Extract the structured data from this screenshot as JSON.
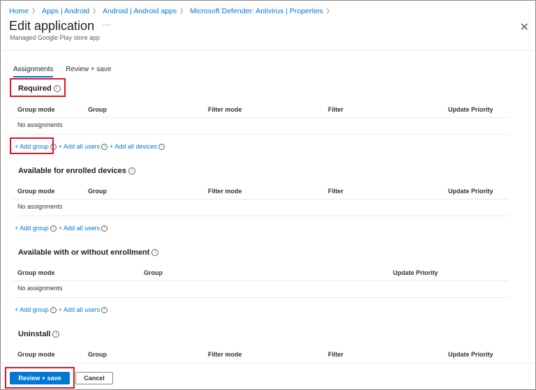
{
  "breadcrumb": [
    "Home",
    "Apps | Android",
    "Android | Android apps",
    "Microsoft Defender: Antivirus | Properties"
  ],
  "header": {
    "title": "Edit application",
    "more": "···",
    "subtitle": "Managed Google Play store app",
    "close": "✕"
  },
  "tabs": [
    "Assignments",
    "Review + save"
  ],
  "sections": {
    "required": {
      "title": "Required",
      "columns": [
        "Group mode",
        "Group",
        "Filter mode",
        "Filter",
        "Update Priority"
      ],
      "empty": "No assignments",
      "links": [
        "+ Add group",
        "+ Add all users",
        "+ Add all devices"
      ]
    },
    "enrolled": {
      "title": "Available for enrolled devices",
      "columns": [
        "Group mode",
        "Group",
        "Filter mode",
        "Filter",
        "Update Priority"
      ],
      "empty": "No assignments",
      "links": [
        "+ Add group",
        "+ Add all users"
      ]
    },
    "without_enrollment": {
      "title": "Available with or without enrollment",
      "columns": [
        "Group mode",
        "Group",
        "Update Priority"
      ],
      "empty": "No assignments",
      "links": [
        "+ Add group",
        "+ Add all users"
      ]
    },
    "uninstall": {
      "title": "Uninstall",
      "columns": [
        "Group mode",
        "Group",
        "Filter mode",
        "Filter",
        "Update Priority"
      ]
    }
  },
  "footer": {
    "review_save": "Review + save",
    "cancel": "Cancel"
  },
  "colors": {
    "accent": "#0078d4",
    "highlight": "#e81123"
  }
}
